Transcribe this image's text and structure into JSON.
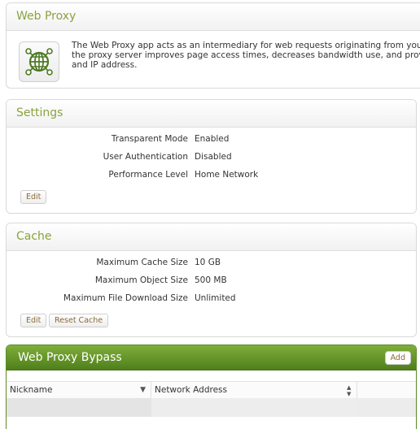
{
  "intro": {
    "title": "Web Proxy",
    "description_lines": [
      "The Web Proxy app acts as an intermediary for web requests originating from your netwo",
      "the proxy server improves page access times, decreases bandwidth use, and provides site",
      "and IP address."
    ],
    "icon": "globe-network-icon"
  },
  "settings": {
    "title": "Settings",
    "rows": [
      {
        "label": "Transparent Mode",
        "value": "Enabled"
      },
      {
        "label": "User Authentication",
        "value": "Disabled"
      },
      {
        "label": "Performance Level",
        "value": "Home Network"
      }
    ],
    "edit_label": "Edit"
  },
  "cache": {
    "title": "Cache",
    "rows": [
      {
        "label": "Maximum Cache Size",
        "value": "10 GB"
      },
      {
        "label": "Maximum Object Size",
        "value": "500 MB"
      },
      {
        "label": "Maximum File Download Size",
        "value": "Unlimited"
      }
    ],
    "edit_label": "Edit",
    "reset_label": "Reset Cache"
  },
  "bypass": {
    "title": "Web Proxy Bypass",
    "add_label": "Add",
    "columns": [
      "Nickname",
      "Network Address"
    ],
    "nickname_sort_icon": "▼",
    "address_sort_icon": "▲▼"
  },
  "colors": {
    "accent": "#8aa33c",
    "header_green": "#5d8a28",
    "button_text": "#8a6a36"
  }
}
